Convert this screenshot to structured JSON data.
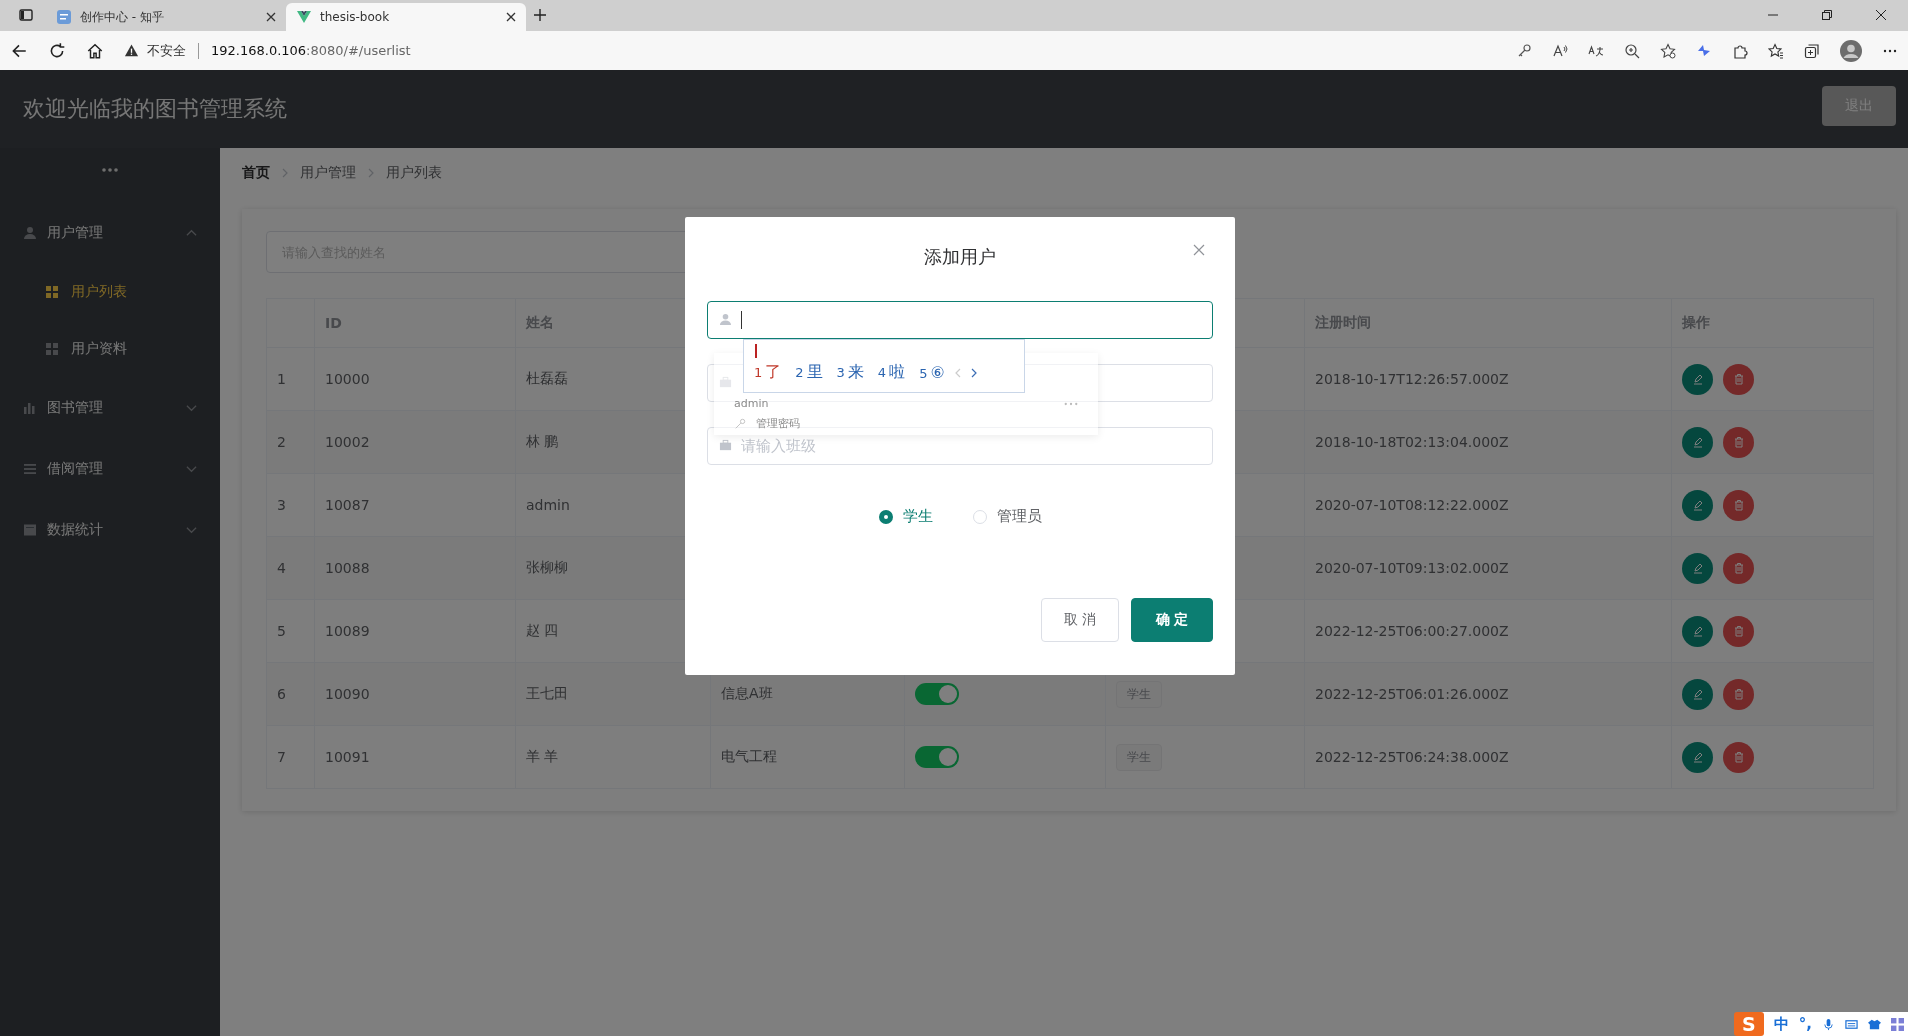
{
  "browser": {
    "tabs": [
      {
        "title": "创作中心 - 知乎",
        "selected": false
      },
      {
        "title": "thesis-book",
        "selected": true
      }
    ],
    "address": {
      "security": "不安全",
      "host": "192.168.0.106",
      "path": ":8080/#/userlist"
    }
  },
  "header": {
    "title": "欢迎光临我的图书管理系统",
    "logout": "退出"
  },
  "sidebar": {
    "menu": [
      {
        "label": "用户管理",
        "expanded": true,
        "children": [
          {
            "label": "用户列表",
            "selected": true
          },
          {
            "label": "用户资料",
            "selected": false
          }
        ]
      },
      {
        "label": "图书管理",
        "expanded": false
      },
      {
        "label": "借阅管理",
        "expanded": false
      },
      {
        "label": "数据统计",
        "expanded": false
      }
    ]
  },
  "breadcrumb": [
    "首页",
    "用户管理",
    "用户列表"
  ],
  "search": {
    "placeholder": "请输入查找的姓名"
  },
  "table": {
    "columns": [
      "ID",
      "姓名",
      "注册时间",
      "操作"
    ],
    "rows": [
      {
        "index": "1",
        "id": "10000",
        "name": "杜磊磊",
        "registered": "2018-10-17T12:26:57.000Z"
      },
      {
        "index": "2",
        "id": "10002",
        "name": "林 鹏",
        "registered": "2018-10-18T02:13:04.000Z"
      },
      {
        "index": "3",
        "id": "10087",
        "name": "admin",
        "registered": "2020-07-10T08:12:22.000Z"
      },
      {
        "index": "4",
        "id": "10088",
        "name": "张柳柳",
        "registered": "2020-07-10T09:13:02.000Z"
      },
      {
        "index": "5",
        "id": "10089",
        "name": "赵 四",
        "registered": "2022-12-25T06:00:27.000Z"
      },
      {
        "index": "6",
        "id": "10090",
        "name": "王七田",
        "class": "信息A班",
        "on": true,
        "role": "学生",
        "registered": "2022-12-25T06:01:26.000Z"
      },
      {
        "index": "7",
        "id": "10091",
        "name": "羊 羊",
        "class": "电气工程",
        "on": true,
        "role": "学生",
        "registered": "2022-12-25T06:24:38.000Z"
      }
    ]
  },
  "modal": {
    "title": "添加用户",
    "fields": [
      {
        "focused": true
      },
      {
        "focused": false
      },
      {
        "focused": false,
        "placeholder": "请输入班级"
      }
    ],
    "autofill": [
      "admin",
      "管理密码"
    ],
    "radios": [
      {
        "label": "学生",
        "selected": true
      },
      {
        "label": "管理员",
        "selected": false
      }
    ],
    "buttons": [
      {
        "label": "取 消",
        "kind": "secondary"
      },
      {
        "label": "确 定",
        "kind": "primary"
      }
    ]
  },
  "ime": {
    "candidates": [
      {
        "number": "1",
        "text": "了",
        "selected": true
      },
      {
        "number": "2",
        "text": "里",
        "selected": false
      },
      {
        "number": "3",
        "text": "来",
        "selected": false
      },
      {
        "number": "4",
        "text": "啦",
        "selected": false
      },
      {
        "number": "5",
        "text": "⑥",
        "selected": false
      }
    ]
  },
  "tray": {
    "logo": "S",
    "mode": "中",
    "punct": "°,"
  }
}
